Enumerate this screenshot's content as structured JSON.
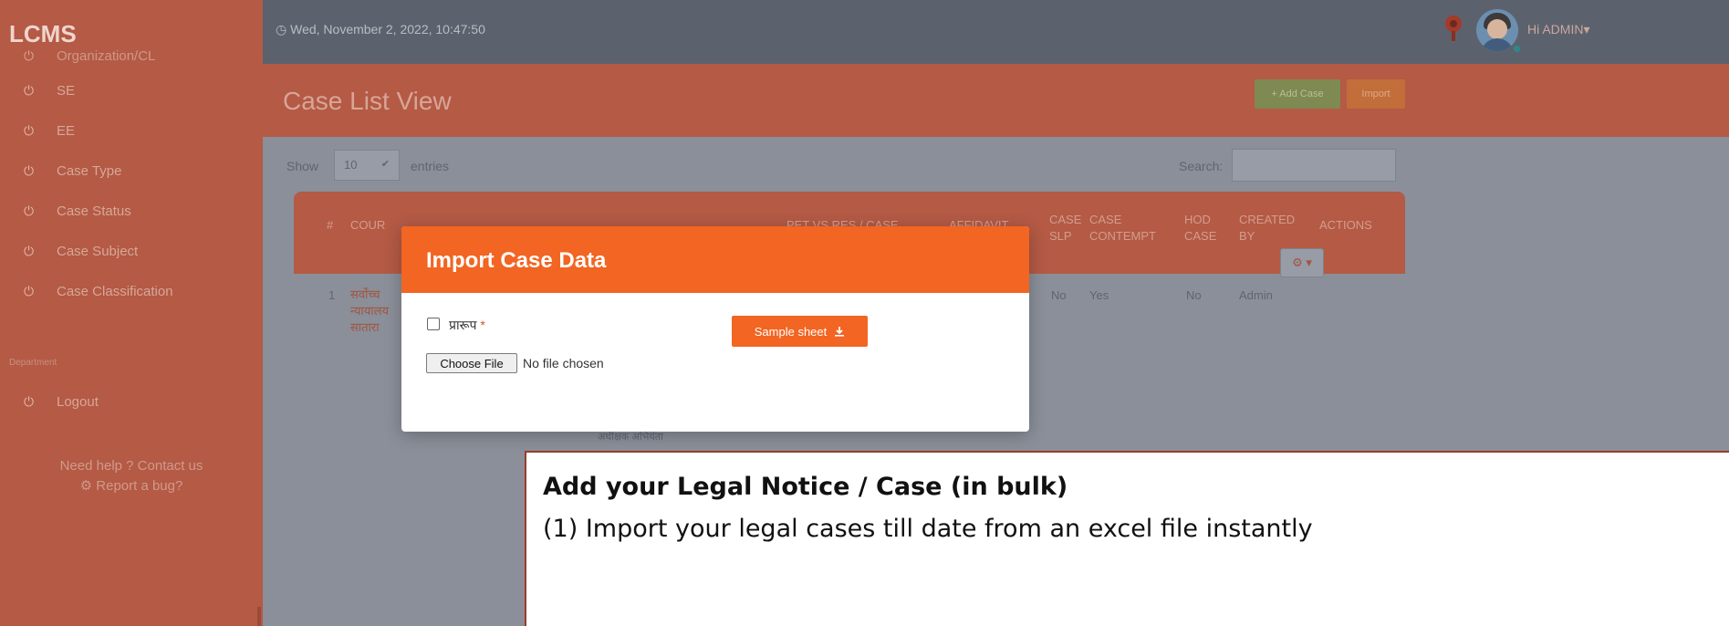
{
  "sidebar": {
    "brand": "LCMS",
    "clipped_item": "Organization/CL",
    "items": [
      {
        "label": "SE",
        "icon": "power-icon"
      },
      {
        "label": "EE",
        "icon": "power-icon"
      },
      {
        "label": "Case Type",
        "icon": "power-icon"
      },
      {
        "label": "Case Status",
        "icon": "power-icon"
      },
      {
        "label": "Case Subject",
        "icon": "power-icon"
      },
      {
        "label": "Case Classification",
        "icon": "power-icon"
      }
    ],
    "section_heading": "Department",
    "logout": "Logout",
    "help": "Need help ? Contact us",
    "bug": "Report a bug?"
  },
  "topbar": {
    "datetime": "Wed, November 2, 2022, 10:47:50",
    "user_menu": "Hi ADMIN"
  },
  "header": {
    "title": "Case List View",
    "add_button": "+ Add Case",
    "import_button": "Import"
  },
  "controls": {
    "show_label": "Show",
    "show_value": "10",
    "entries_label": "entries",
    "search_label": "Search:"
  },
  "table": {
    "columns": [
      "#",
      "COUR",
      "PET VS RES / CASE",
      "AFFIDAVIT",
      "CASE SLP",
      "CASE CONTEMPT",
      "HOD CASE",
      "CREATED BY",
      "ACTIONS"
    ],
    "row": {
      "index": "1",
      "court": "सर्वोच्च न्यायालय सातारा",
      "slp": "No",
      "contempt": "Yes",
      "hod": "No",
      "created_by": "Admin"
    },
    "partial_text": "अधीक्षक अभियंता"
  },
  "modal": {
    "title": "Import Case Data",
    "checkbox_label": "प्रारूप",
    "required_mark": "*",
    "choose_file": "Choose File",
    "no_file": "No file chosen",
    "sample_sheet": "Sample sheet"
  },
  "callout": {
    "title": "Add your Legal Notice / Case (in bulk)",
    "line1": "(1) Import your legal cases till date from an excel file instantly"
  },
  "colors": {
    "accent_orange": "#f26522",
    "overlay_sidebar": "#b45a45",
    "callout_border": "#9b3b2b"
  }
}
